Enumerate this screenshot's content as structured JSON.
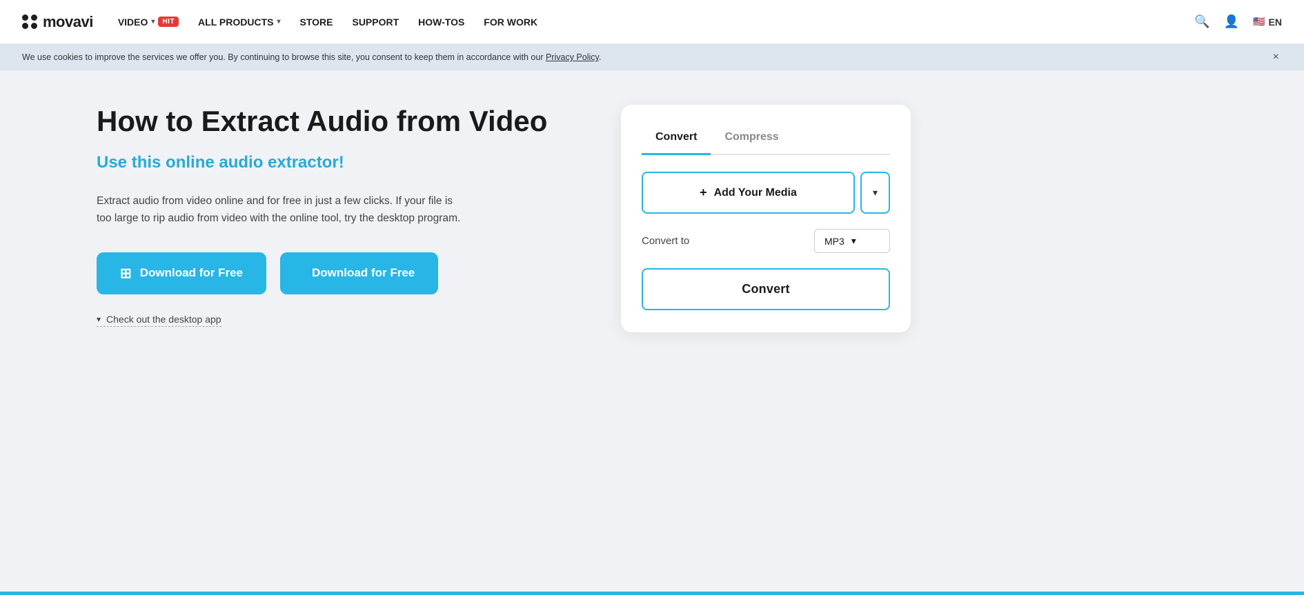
{
  "header": {
    "logo_text": "movavi",
    "nav": [
      {
        "label": "VIDEO",
        "badge": "HIT",
        "has_dropdown": true
      },
      {
        "label": "ALL PRODUCTS",
        "has_dropdown": true
      },
      {
        "label": "STORE",
        "has_dropdown": false
      },
      {
        "label": "SUPPORT",
        "has_dropdown": false
      },
      {
        "label": "HOW-TOS",
        "has_dropdown": false
      },
      {
        "label": "FOR WORK",
        "has_dropdown": false
      }
    ],
    "lang": "EN",
    "search_title": "Search",
    "login_title": "Login"
  },
  "cookie_banner": {
    "text": "We use cookies to improve the services we offer you. By continuing to browse this site, you consent to keep them in accordance with our",
    "link_text": "Privacy Policy",
    "close_label": "×"
  },
  "main": {
    "title": "How to Extract Audio from Video",
    "subtitle": "Use this online audio extractor!",
    "description": "Extract audio from video online and for free in just a few clicks. If your file is too large to rip audio from video with the online tool, try the desktop program.",
    "download_windows": "Download for Free",
    "download_mac": "Download for Free",
    "desktop_app_link": "Check out the desktop app"
  },
  "converter": {
    "tab_convert": "Convert",
    "tab_compress": "Compress",
    "add_media_label": "+ Add Your Media",
    "add_icon": "+",
    "add_text": "Add Your Media",
    "dropdown_icon": "▾",
    "convert_to_label": "Convert to",
    "format_selected": "MP3",
    "format_dropdown_icon": "▾",
    "convert_button": "Convert"
  }
}
